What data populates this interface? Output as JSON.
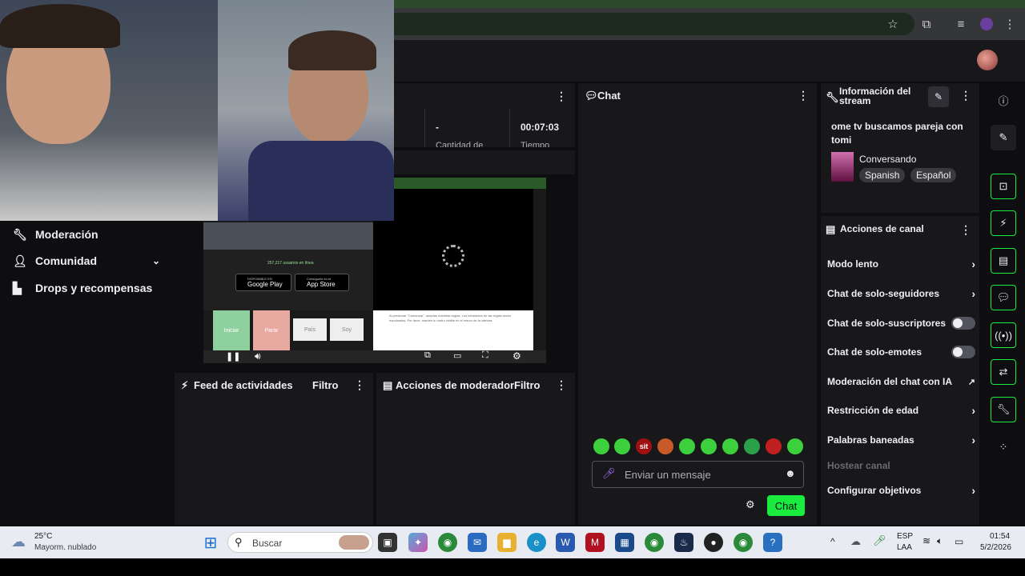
{
  "stats": {
    "value1": "-",
    "value2": "00:07:03",
    "label1": "Cantidad de",
    "label2": "Tiempo"
  },
  "left_nav": {
    "items": [
      {
        "label": "Moderación",
        "icon": "wrench-icon"
      },
      {
        "label": "Comunidad",
        "icon": "community-icon"
      },
      {
        "label": "Drops y recompensas",
        "icon": "drops-icon"
      }
    ]
  },
  "preview": {
    "users_online": "257,217 usuarios en línea",
    "google_play": "Google Play",
    "google_play_small": "DISPONIBLE EN",
    "app_store": "App Store",
    "app_store_small": "Consíguelo en el",
    "btn_start": "Iniciar",
    "btn_stop": "Parar",
    "btn_country": "País",
    "btn_soy": "Soy",
    "disclaimer": "Al presionar \"Comenzar\", aceptas nuestras reglas. Los infractores de las reglas serán expulsados. Por favor, mantén tu rostro visible en el marco de la cámara."
  },
  "feed": {
    "title": "Feed de actividades",
    "filter": "Filtro"
  },
  "mod_actions": {
    "title": "Acciones de moderador",
    "filter": "Filtro"
  },
  "chat": {
    "title": "Chat",
    "placeholder": "Enviar un mensaje",
    "button": "Chat",
    "emotes": [
      "",
      "",
      "sit",
      "",
      "",
      "",
      "",
      "",
      "",
      ""
    ]
  },
  "stream_info": {
    "title": "Información del stream",
    "stream_title": "ome tv buscamos pareja con tomi",
    "category": "Conversando",
    "tags": [
      "Spanish",
      "Español"
    ]
  },
  "channel_actions": {
    "title": "Acciones de canal",
    "items": [
      {
        "label": "Modo lento",
        "control": "chevron"
      },
      {
        "label": "Chat de solo-seguidores",
        "control": "chevron"
      },
      {
        "label": "Chat de solo-suscriptores",
        "control": "toggle"
      },
      {
        "label": "Chat de solo-emotes",
        "control": "toggle"
      },
      {
        "label": "Moderación del chat con IA",
        "control": "external"
      },
      {
        "label": "Restricción de edad",
        "control": "chevron"
      },
      {
        "label": "Palabras baneadas",
        "control": "chevron"
      },
      {
        "label": "Hostear canal",
        "control": "disabled"
      },
      {
        "label": "Configurar objetivos",
        "control": "chevron"
      }
    ]
  },
  "taskbar": {
    "weather_temp": "25°C",
    "weather_desc": "Mayorm. nublado",
    "search": "Buscar",
    "lang_top": "ESP",
    "lang_bottom": "LAA",
    "time": "01:54",
    "date": "5/2/2026"
  },
  "colors": {
    "accent": "#1aeb3f",
    "bg": "#0e0e10",
    "panel": "#18181b"
  }
}
